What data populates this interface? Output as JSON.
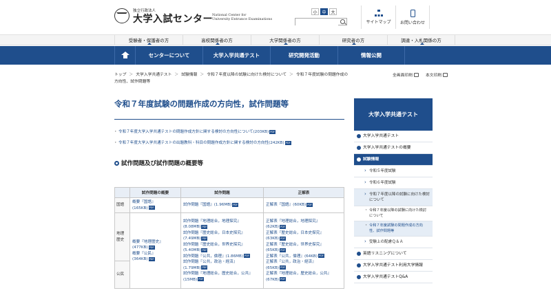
{
  "header": {
    "sub": "独立行政法人",
    "title": "大学入試センター",
    "en_line1": "National Center for",
    "en_line2": "University Entrance Examinations",
    "font_label": "文字サイズ",
    "font_sizes": [
      "小",
      "中",
      "大"
    ],
    "search_placeholder": "",
    "sitemap": "サイトマップ",
    "contact": "お問い合わせ"
  },
  "audience": [
    "受験者・保護者の方",
    "高校関係者の方",
    "大学関係者の方",
    "研究者の方",
    "調達・入札関係の方"
  ],
  "gnav": [
    "センターについて",
    "大学入学共通テスト",
    "研究開発活動",
    "情報公開"
  ],
  "breadcrumb": [
    "トップ",
    "大学入学共通テスト",
    "試験情報",
    "令和７年度以降の試験に向けた検討について",
    "令和７年度試験の問題作成の方向性、試作問題等"
  ],
  "print": {
    "all": "全画面印刷",
    "body": "本文印刷"
  },
  "main": {
    "title": "令和７年度試験の問題作成の方向性，試作問題等",
    "links": [
      "令和７年度大学入学共通テストの問題作成方針に関する検討の方向性について(203KB)",
      "令和７年度大学入学共通テストの出題教科・科目の問題作成方針に関する検討の方向性(242KB)"
    ],
    "pdf": "PDF",
    "section_title": "試作問題及び試作問題の概要等"
  },
  "table": {
    "headers": [
      "試作問題の概要",
      "試作問題",
      "正解表"
    ],
    "rows": [
      {
        "subject": "国語",
        "overview": [
          "概要『国語』",
          "(165KB)"
        ],
        "problems": [
          "試作問題『国語』(1.96MB)"
        ],
        "answers": [
          "正解表『国語』(60KB)"
        ]
      },
      {
        "subject": "地理歴史",
        "overview": [
          "概要『地理歴史』",
          "(477KB)",
          "概要『公民』",
          "(364KB)"
        ],
        "problems": [
          "試作問題『地理総合，地理探究』",
          "(8.08MB)",
          "試作問題『歴史総合，日本史探究』",
          "(7.49MB)",
          "試作問題『歴史総合，世界史探究』",
          "(5.40MB)",
          "試作問題『公共，倫理』(1.86MB)",
          "試作問題『公共，政治・経済』",
          "(1.79MB)",
          "試作問題『地理総合，歴史総合，公共』",
          "(15MB)"
        ],
        "answers": [
          "正解表『地理総合，地理探究』",
          "(62KB)",
          "正解表『歴史総合，日本史探究』",
          "(63KB)",
          "正解表『歴史総合，世界史探究』",
          "(65KB)",
          "正解表『公共，倫理』(64KB)",
          "正解表『公共，政治・経済』",
          "(65KB)",
          "正解表『地理総合，歴史総合，公共』",
          "(67KB)"
        ]
      },
      {
        "subject": "公民"
      }
    ]
  },
  "sidebar": {
    "head": "大学入学共通テスト",
    "items": [
      "大学入学共通テスト",
      "大学入学共通テストの概要",
      "試験情報"
    ],
    "subs": [
      "令和５年度試験",
      "令和６年度試験",
      "令和７年度以降の試験に向けた検討について"
    ],
    "subsubs": [
      "令和７年度以降の試験に向けた検討について",
      "令和７年度試験の問題作成の方向性、試作問題等"
    ],
    "sub_after": "受験上の配慮Ｑ＆Ａ",
    "items_after": [
      "英語リスニングについて",
      "大学入学共通テスト利用大学情報",
      "大学入学共通テストQ&A"
    ]
  },
  "colors": {
    "brand": "#1f4e8c"
  }
}
